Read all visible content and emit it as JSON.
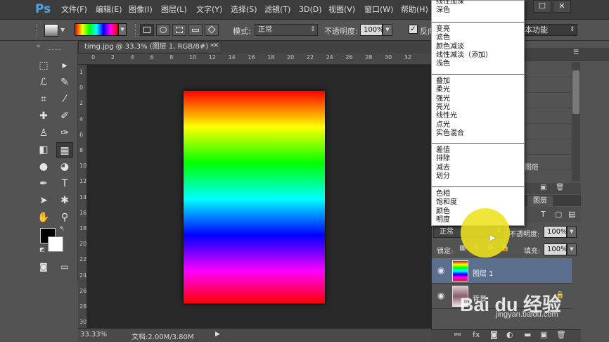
{
  "app": {
    "logo": "Ps"
  },
  "menu": [
    "文件(F)",
    "编辑(E)",
    "图像(I)",
    "图层(L)",
    "文字(Y)",
    "选择(S)",
    "滤镜(T)",
    "3D(D)",
    "视图(V)",
    "窗口(W)",
    "帮助(H)"
  ],
  "window_controls": {
    "minimize": "▬",
    "maximize": "☐",
    "close": "✕"
  },
  "options_bar": {
    "mode_label": "模式:",
    "mode_value": "正常",
    "opacity_label": "不透明度:",
    "opacity_value": "100%",
    "reverse_label": "反向",
    "workspace": "本功能"
  },
  "document": {
    "tab_title": "timg.jpg @ 33.3% (图层 1, RGB/8#) *",
    "tab_close": "×",
    "zoom": "33.33%",
    "doc_size": "文档:2.00M/3.80M",
    "ruler_top_labels": [
      "0",
      "2",
      "4",
      "6",
      "8",
      "10",
      "12",
      "14",
      "16",
      "18",
      "20",
      "22",
      "24",
      "26",
      "28",
      "30",
      "32"
    ],
    "ruler_left_labels": [
      "1",
      "0",
      "2",
      "4",
      "6",
      "8",
      "10",
      "12",
      "14",
      "16",
      "18",
      "20",
      "22",
      "24",
      "26",
      "28",
      "30"
    ]
  },
  "history": {
    "row_fragment_1": "l",
    "row_fragment_2": "图层"
  },
  "layers_panel": {
    "tab": "图层",
    "blend_mode": "正常",
    "opacity_label": "不透明度:",
    "opacity_value": "100%",
    "lock_label": "锁定:",
    "fill_label": "填充:",
    "fill_value": "100%",
    "layers": [
      {
        "name": "图层 1",
        "selected": true
      },
      {
        "name": "背景",
        "selected": false
      }
    ]
  },
  "blend_menu": {
    "groups": [
      [
        "线性加深",
        "深色"
      ],
      [
        "变亮",
        "滤色",
        "颜色减淡",
        "线性减淡（添加）",
        "浅色"
      ],
      [
        "叠加",
        "柔光",
        "强光",
        "亮光",
        "线性光",
        "点光",
        "实色混合"
      ],
      [
        "差值",
        "排除",
        "减去",
        "划分"
      ],
      [
        "色相",
        "饱和度",
        "颜色",
        "明度"
      ]
    ]
  },
  "watermark": {
    "logo": "Bai du 经验",
    "url": "jingyan.baidu.com"
  },
  "colors": {
    "foreground": "#000000",
    "background": "#ffffff",
    "selected_layer": "#5b6f8f"
  }
}
